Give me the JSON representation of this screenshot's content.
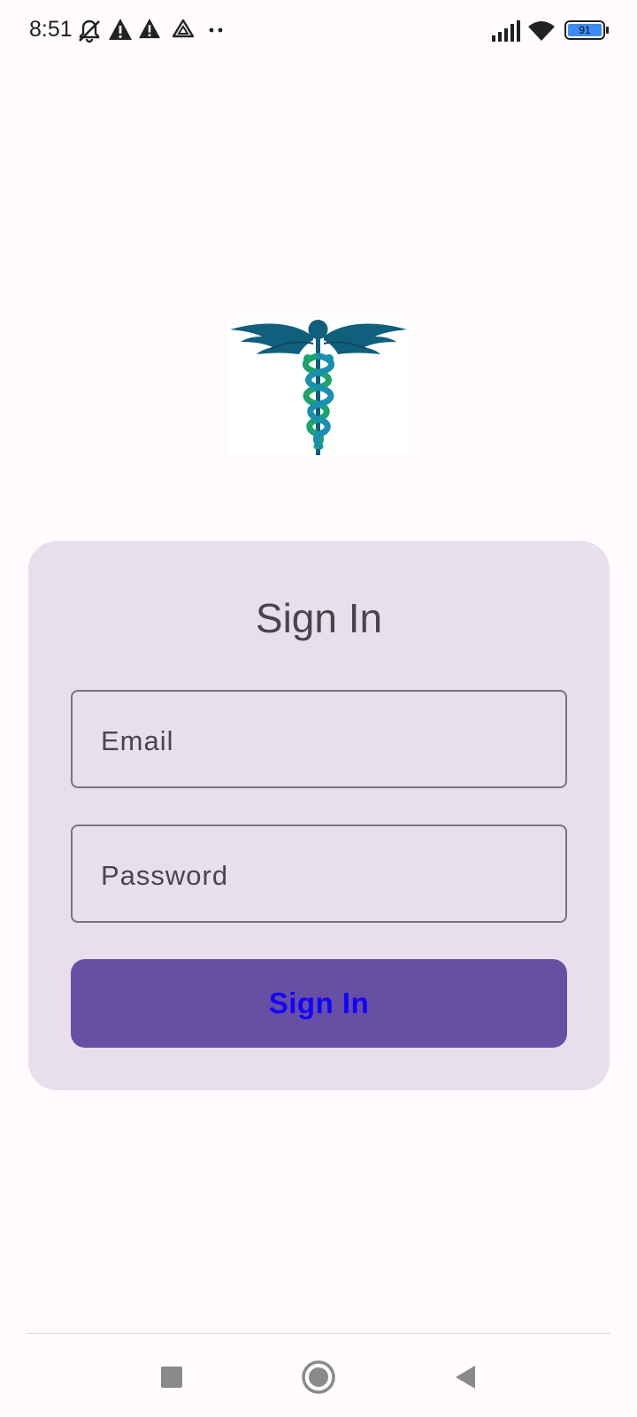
{
  "status_bar": {
    "time": "8:51",
    "battery_level": "91",
    "icons": [
      "muted-bell-icon",
      "warning-icon",
      "warning-icon",
      "drive-icon",
      "more-dots-icon",
      "signal-icon",
      "wifi-icon",
      "battery-icon"
    ]
  },
  "logo": {
    "icon": "caduceus-icon",
    "colors": {
      "wings": "#0f5f7d",
      "snake_green": "#1aa36a",
      "snake_blue": "#1a8fb0"
    }
  },
  "signin_card": {
    "title": "Sign In",
    "email_placeholder": "Email",
    "password_placeholder": "Password",
    "button_label": "Sign In",
    "colors": {
      "card_bg": "#e7e0ec",
      "button_bg": "#6750a4",
      "button_text": "#1400ff"
    }
  },
  "nav_bar": {
    "icons": [
      "recents-square-icon",
      "home-circle-icon",
      "back-triangle-icon"
    ]
  }
}
